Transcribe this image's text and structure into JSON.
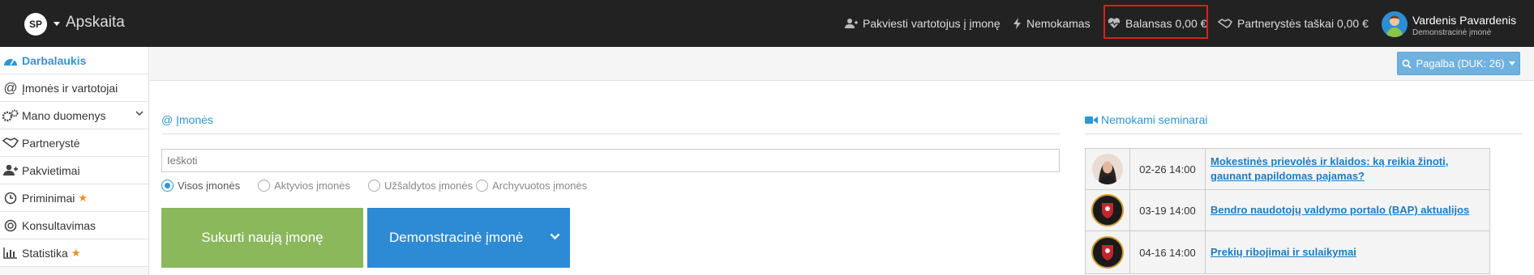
{
  "topbar": {
    "logo_text": "SP",
    "app_title": "Apskaita",
    "invite_label": "Pakviesti vartotojus į įmonę",
    "plan_label": "Nemokamas",
    "balance_label": "Balansas 0,00 €",
    "partner_points_label": "Partnerystės taškai 0,00 €",
    "user_name": "Vardenis Pavardenis",
    "user_company": "Demonstracinė įmonė"
  },
  "sidebar": {
    "items": [
      {
        "label": "Darbalaukis",
        "icon": "dashboard-icon"
      },
      {
        "label": "Įmonės ir vartotojai",
        "icon": "at-icon"
      },
      {
        "label": "Mano duomenys",
        "icon": "gears-icon"
      },
      {
        "label": "Partnerystė",
        "icon": "handshake-icon"
      },
      {
        "label": "Pakvietimai",
        "icon": "user-plus-icon"
      },
      {
        "label": "Priminimai",
        "icon": "clock-icon"
      },
      {
        "label": "Konsultavimas",
        "icon": "lifebuoy-icon"
      },
      {
        "label": "Statistika",
        "icon": "bar-chart-icon"
      }
    ]
  },
  "help": {
    "label": "Pagalba (DUK: 26)"
  },
  "companies": {
    "title": "@ Įmonės",
    "search_placeholder": "Ieškoti",
    "filters": [
      "Visos įmonės",
      "Aktyvios įmonės",
      "Užšaldytos įmonės",
      "Archyvuotos įmonės"
    ],
    "selected_filter": "Visos įmonės",
    "create_button": "Sukurti naują įmonę",
    "demo_button": "Demonstracinė įmonė"
  },
  "seminars": {
    "title": "Nemokami seminarai",
    "rows": [
      {
        "date": "02-26 14:00",
        "title": "Mokestinės prievolės ir klaidos: ką reikia žinoti, gaunant papildomas pajamas?"
      },
      {
        "date": "03-19 14:00",
        "title": "Bendro naudotojų valdymo portalo (BAP) aktualijos"
      },
      {
        "date": "04-16 14:00",
        "title": "Prekių ribojimai ir sulaikymai"
      }
    ]
  },
  "colors": {
    "accent": "#2f95d3",
    "create": "#8ab85b",
    "demo": "#2d8ad4",
    "highlight": "#e21c1c"
  }
}
